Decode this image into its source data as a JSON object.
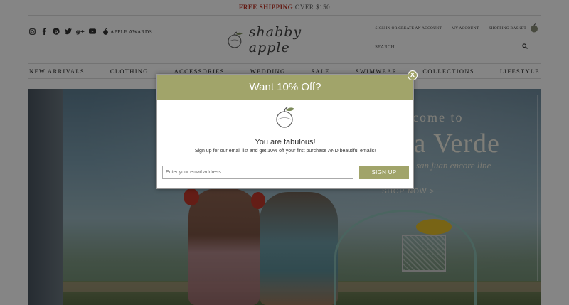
{
  "promo": {
    "highlight": "FREE SHIPPING",
    "rest": "OVER $150"
  },
  "social": {
    "icons": [
      "instagram-icon",
      "facebook-icon",
      "pinterest-icon",
      "twitter-icon",
      "google-plus-icon",
      "youtube-icon"
    ],
    "awards_label": "APPLE AWARDS"
  },
  "logo": {
    "text": "shabby apple"
  },
  "account": {
    "sign_in": "SIGN IN OR CREATE AN ACCOUNT",
    "my_account": "MY ACCOUNT",
    "basket": "SHOPPING BASKET"
  },
  "search": {
    "placeholder": "SEARCH"
  },
  "nav": [
    "NEW ARRIVALS",
    "CLOTHING",
    "ACCESSORIES",
    "WEDDING",
    "SALE",
    "SWIMWEAR",
    "COLLECTIONS",
    "LIFESTYLE"
  ],
  "hero": {
    "welcome": "come to",
    "headline": "la Verde",
    "subline": "san juan encore line",
    "cta": "SHOP NOW >"
  },
  "modal": {
    "header": "Want 10% Off?",
    "close": "X",
    "title": "You are fabulous!",
    "description": "Sign up for our email list and get 10% off your first purchase AND beautiful emails!",
    "email_placeholder": "Enter your email address",
    "button": "SIGN UP"
  },
  "colors": {
    "accent": "#a1a46a",
    "promo_red": "#c0392b"
  }
}
